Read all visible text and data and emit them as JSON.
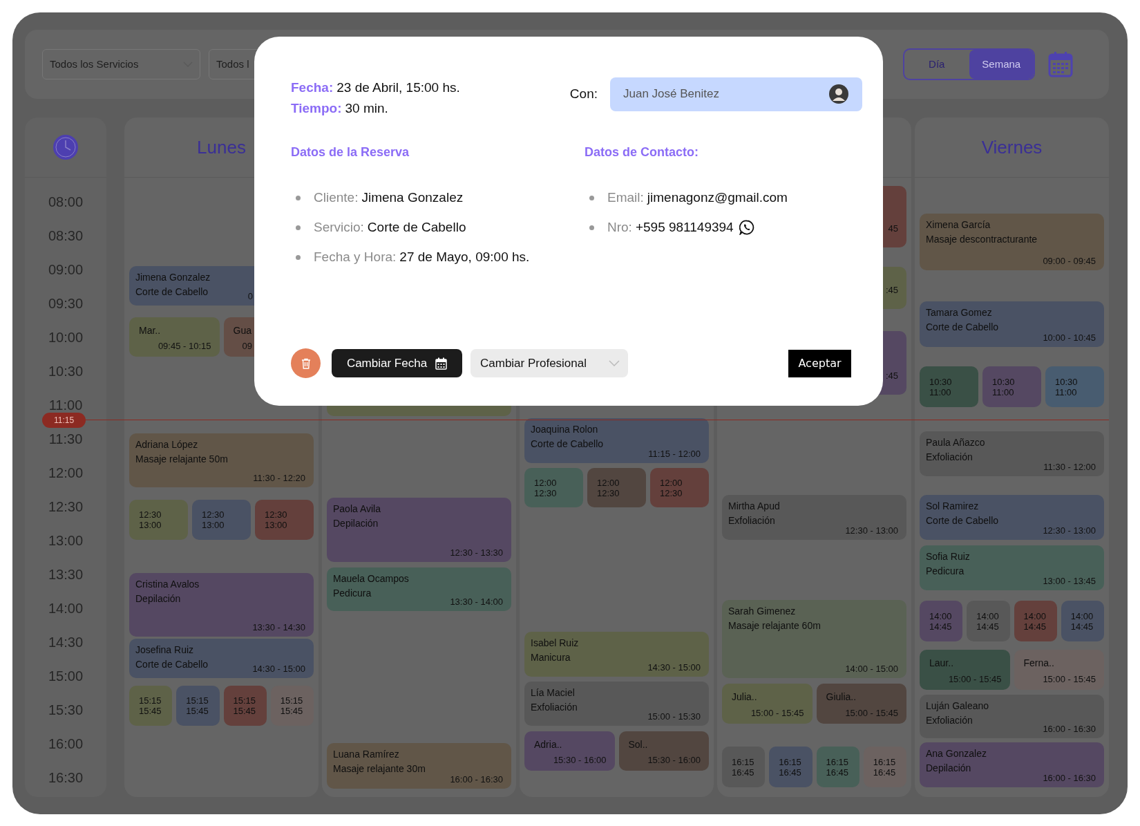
{
  "filters": [
    {
      "label": "Todos los Servicios"
    },
    {
      "label": "Todos l"
    }
  ],
  "view_toggle": [
    {
      "label": "Día",
      "selected": false
    },
    {
      "label": "Semana",
      "selected": true
    }
  ],
  "time_slots": [
    "08:00",
    "08:30",
    "09:00",
    "09:30",
    "10:00",
    "10:30",
    "11:00",
    "11:30",
    "12:00",
    "12:30",
    "13:00",
    "13:30",
    "14:00",
    "14:30",
    "15:00",
    "15:30",
    "16:00",
    "16:30"
  ],
  "current_time": "11:15",
  "days": [
    {
      "name": "Lunes",
      "slots": [
        [
          {
            "kind": "booking",
            "name": "Jimena Gonzalez",
            "service": "Corte de Cabello",
            "time": "0",
            "color": "#4a5264"
          }
        ],
        [
          {
            "kind": "short",
            "name": "Mar..",
            "time": "09:45 - 10:15",
            "color": "#5e6248"
          },
          {
            "kind": "short",
            "name": "Gua",
            "time": "09",
            "color": "#644e46"
          }
        ],
        [
          {
            "kind": "booking",
            "name": "Adriana López",
            "service": "Masaje relajante 50m",
            "time": "11:30 - 12:20",
            "color": "#615648"
          }
        ],
        [
          {
            "kind": "slot",
            "start": "12:30",
            "end": "13:00",
            "color": "#5e6248"
          },
          {
            "kind": "slot",
            "start": "12:30",
            "end": "13:00",
            "color": "#4a5264"
          },
          {
            "kind": "slot",
            "start": "12:30",
            "end": "13:00",
            "color": "#64403c"
          }
        ],
        [
          {
            "kind": "booking",
            "name": "Cristina Avalos",
            "service": "Depilación",
            "time": "13:30 - 14:30",
            "color": "#554862"
          }
        ],
        [
          {
            "kind": "booking",
            "name": "Josefina Ruiz",
            "service": "Corte de Cabello",
            "time": "14:30 - 15:00",
            "color": "#4a5264"
          }
        ],
        [
          {
            "kind": "slot",
            "start": "15:15",
            "end": "15:45",
            "color": "#5e6248"
          },
          {
            "kind": "slot",
            "start": "15:15",
            "end": "15:45",
            "color": "#4a5264"
          },
          {
            "kind": "slot",
            "start": "15:15",
            "end": "15:45",
            "color": "#64403c"
          },
          {
            "kind": "slot",
            "start": "15:15",
            "end": "15:45",
            "color": "#6c6260"
          }
        ]
      ]
    },
    {
      "slots": [
        [
          {
            "kind": "fragment",
            "color": "#5e6248"
          }
        ],
        [
          {
            "kind": "booking",
            "name": "Paola Avila",
            "service": "Depilación",
            "time": "12:30 - 13:30",
            "color": "#554862"
          }
        ],
        [
          {
            "kind": "booking",
            "name": "Mauela Ocampos",
            "service": "Pedicura",
            "time": "13:30 - 14:00",
            "color": "#486058"
          }
        ],
        [
          {
            "kind": "booking",
            "name": "Luana Ramírez",
            "service": "Masaje relajante 30m",
            "time": "16:00 - 16:30",
            "color": "#615648"
          }
        ]
      ]
    },
    {
      "slots": [
        [
          {
            "kind": "booking",
            "name": "Joaquina Rolon",
            "service": "Corte de Cabello",
            "time": "11:15 - 12:00",
            "color": "#4a5264"
          }
        ],
        [
          {
            "kind": "slot",
            "start": "12:00",
            "end": "12:30",
            "color": "#486058"
          },
          {
            "kind": "slot",
            "start": "12:00",
            "end": "12:30",
            "color": "#524640"
          },
          {
            "kind": "slot",
            "start": "12:00",
            "end": "12:30",
            "color": "#64403c"
          }
        ],
        [
          {
            "kind": "booking",
            "name": "Isabel Ruiz",
            "service": "Manicura",
            "time": "14:30 - 15:00",
            "color": "#5e6248"
          }
        ],
        [
          {
            "kind": "booking",
            "name": "Lía Maciel",
            "service": "Exfoliación",
            "time": "15:00 - 15:30",
            "color": "#585858"
          }
        ],
        [
          {
            "kind": "short",
            "name": "Adria..",
            "time": "15:30 - 16:00",
            "color": "#554862"
          },
          {
            "kind": "short",
            "name": "Sol..",
            "time": "15:30 - 16:00",
            "color": "#524640"
          }
        ]
      ]
    },
    {
      "slots": [
        [
          {
            "kind": "fragment",
            "time": "45",
            "color": "#64403c"
          }
        ],
        [
          {
            "kind": "fragment",
            "time": ":45",
            "color": "#5e6248"
          }
        ],
        [
          {
            "kind": "fragment",
            "time": ":45",
            "color": "#554862"
          }
        ],
        [
          {
            "kind": "booking",
            "name": "Mirtha Apud",
            "service": "Exfoliación",
            "time": "12:30 - 13:00",
            "color": "#585858"
          }
        ],
        [
          {
            "kind": "booking",
            "name": "Sarah Gimenez",
            "service": "Masaje relajante 60m",
            "time": "14:00 - 15:00",
            "color": "#5a6254"
          }
        ],
        [
          {
            "kind": "short",
            "name": "Julia..",
            "time": "15:00 - 15:45",
            "color": "#5e6248"
          },
          {
            "kind": "short",
            "name": "Giulia..",
            "time": "15:00 - 15:45",
            "color": "#524640"
          }
        ],
        [
          {
            "kind": "slot",
            "start": "16:15",
            "end": "16:45",
            "color": "#585858"
          },
          {
            "kind": "slot",
            "start": "16:15",
            "end": "16:45",
            "color": "#4a5264"
          },
          {
            "kind": "slot",
            "start": "16:15",
            "end": "16:45",
            "color": "#486058"
          },
          {
            "kind": "slot",
            "start": "16:15",
            "end": "16:45",
            "color": "#6c6260"
          }
        ]
      ]
    },
    {
      "name": "Viernes",
      "slots": [
        [
          {
            "kind": "booking",
            "name": "Ximena García",
            "service": "Masaje descontracturante",
            "time": "09:00 - 09:45",
            "color": "#615648"
          }
        ],
        [
          {
            "kind": "booking",
            "name": "Tamara Gomez",
            "service": "Corte de Cabello",
            "time": "10:00 - 10:45",
            "color": "#4a5264"
          }
        ],
        [
          {
            "kind": "slot",
            "start": "10:30",
            "end": "11:00",
            "color": "#3a5046"
          },
          {
            "kind": "slot",
            "start": "10:30",
            "end": "11:00",
            "color": "#554862"
          },
          {
            "kind": "slot",
            "start": "10:30",
            "end": "11:00",
            "color": "#485c70"
          }
        ],
        [
          {
            "kind": "booking",
            "name": "Paula Añazco",
            "service": "Exfoliación",
            "time": "11:30 - 12:00",
            "color": "#585858"
          }
        ],
        [
          {
            "kind": "booking",
            "name": "Sol Ramirez",
            "service": "Corte de Cabello",
            "time": "12:30 - 13:00",
            "color": "#4a5264"
          }
        ],
        [
          {
            "kind": "booking",
            "name": "Sofia Ruiz",
            "service": "Pedicura",
            "time": "13:00 - 13:45",
            "color": "#486058"
          }
        ],
        [
          {
            "kind": "slot",
            "start": "14:00",
            "end": "14:45",
            "color": "#554862"
          },
          {
            "kind": "slot",
            "start": "14:00",
            "end": "14:45",
            "color": "#585858"
          },
          {
            "kind": "slot",
            "start": "14:00",
            "end": "14:45",
            "color": "#64403c"
          },
          {
            "kind": "slot",
            "start": "14:00",
            "end": "14:45",
            "color": "#4a5264"
          }
        ],
        [
          {
            "kind": "short",
            "name": "Laur..",
            "time": "15:00 - 15:45",
            "color": "#3a5046"
          },
          {
            "kind": "short",
            "name": "Ferna..",
            "time": "15:00 - 15:45",
            "color": "#6c6260"
          }
        ],
        [
          {
            "kind": "booking",
            "name": "Luján Galeano",
            "service": "Exfoliación",
            "time": "16:00 - 16:30",
            "color": "#585858"
          }
        ],
        [
          {
            "kind": "booking",
            "name": "Ana Gonzalez",
            "service": "Depilación",
            "time": "16:00 - 16:30",
            "color": "#554862"
          }
        ]
      ]
    }
  ],
  "modal": {
    "fecha": {
      "label": "Fecha:",
      "value": "23 de Abril, 15:00 hs."
    },
    "tiempo": {
      "label": "Tiempo:",
      "value": "30 min."
    },
    "con": {
      "label": "Con:",
      "professional": "Juan José Benitez"
    },
    "reserva": {
      "title": "Datos de la Reserva",
      "items": [
        {
          "label": "Cliente:",
          "value": "Jimena Gonzalez"
        },
        {
          "label": "Servicio:",
          "value": "Corte de Cabello"
        },
        {
          "label": "Fecha y Hora:",
          "value": "27 de Mayo, 09:00 hs."
        }
      ]
    },
    "contacto": {
      "title": "Datos de Contacto:",
      "items": [
        {
          "kind": "email",
          "label": "Email:",
          "value": "jimenagonz@gmail.com"
        },
        {
          "kind": "phone",
          "label": "Nro:",
          "value": "+595 981149394"
        }
      ]
    },
    "change_date": "Cambiar Fecha",
    "change_professional": "Cambiar Profesional",
    "accept": "Aceptar"
  }
}
